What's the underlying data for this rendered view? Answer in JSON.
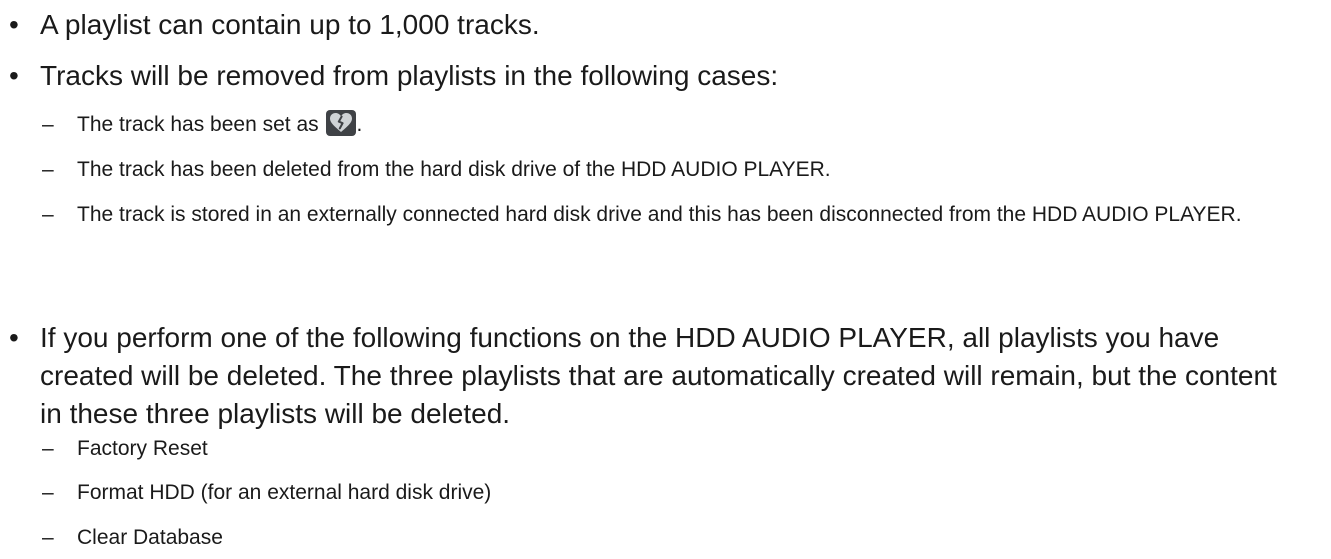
{
  "document": {
    "bullets": [
      {
        "text": "A playlist can contain up to 1,000 tracks."
      },
      {
        "text": "Tracks will be removed from playlists in the following cases:"
      },
      {
        "text": "If you perform one of the following functions on the HDD AUDIO PLAYER, all playlists you have created will be deleted. The three playlists that are automatically created will remain, but the content in these three playlists will be deleted."
      }
    ],
    "removal_cases": [
      {
        "before": "The track has been set as",
        "icon": "broken-heart-icon",
        "after": "."
      },
      {
        "text": "The track has been deleted from the hard disk drive of the HDD AUDIO PLAYER."
      },
      {
        "text": "The track is stored in an externally connected hard disk drive and this has been disconnected from the HDD AUDIO PLAYER."
      }
    ],
    "delete_functions": [
      {
        "text": "Factory Reset"
      },
      {
        "text": "Format HDD (for an external hard disk drive)"
      },
      {
        "text": "Clear Database"
      }
    ],
    "bullet_glyph": "•",
    "dash_glyph": "–",
    "colors": {
      "text": "#1a1a1a",
      "icon_background": "#3f4246",
      "icon_heart": "#cfd3d6"
    }
  }
}
